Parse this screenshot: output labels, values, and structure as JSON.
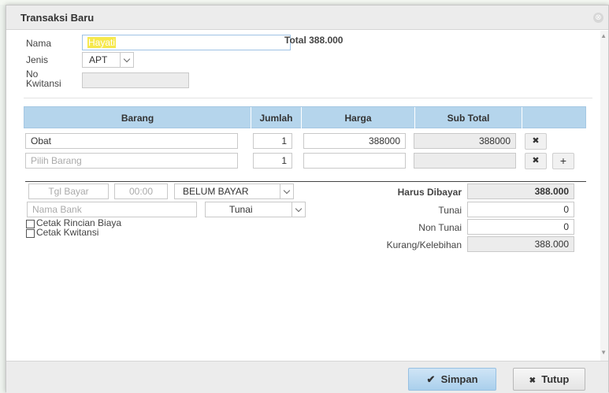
{
  "dialog": {
    "title": "Transaksi Baru",
    "close_glyph": "⊗"
  },
  "form": {
    "nama_label": "Nama",
    "nama_value": "Hayati",
    "total_label": "Total 388.000",
    "jenis_label": "Jenis",
    "jenis_value": "APT",
    "no_label_1": "No",
    "no_label_2": "Kwitansi",
    "no_value": ""
  },
  "table": {
    "headers": [
      "Barang",
      "Jumlah",
      "Harga",
      "Sub Total"
    ],
    "rows": [
      {
        "barang": "Obat",
        "jumlah": "1",
        "harga": "388000",
        "subtotal": "388000"
      },
      {
        "barang_placeholder": "Pilih Barang",
        "jumlah": "1",
        "harga": "",
        "subtotal": ""
      }
    ],
    "remove_glyph": "✖",
    "add_glyph": "+"
  },
  "payment": {
    "tgl_placeholder": "Tgl Bayar",
    "time_placeholder": "00:00",
    "status_value": "BELUM BAYAR",
    "bank_placeholder": "Nama Bank",
    "method_value": "Tunai",
    "cetak_rincian": "Cetak Rincian Biaya",
    "cetak_kwitansi": "Cetak Kwitansi",
    "harus_dibayar_label": "Harus Dibayar",
    "harus_dibayar_value": "388.000",
    "tunai_label": "Tunai",
    "tunai_value": "0",
    "non_tunai_label": "Non Tunai",
    "non_tunai_value": "0",
    "kurang_label": "Kurang/Kelebihan",
    "kurang_value": "388.000"
  },
  "footer": {
    "save_label": "Simpan",
    "save_icon": "✔",
    "close_label": "Tutup",
    "close_icon": "✖"
  }
}
